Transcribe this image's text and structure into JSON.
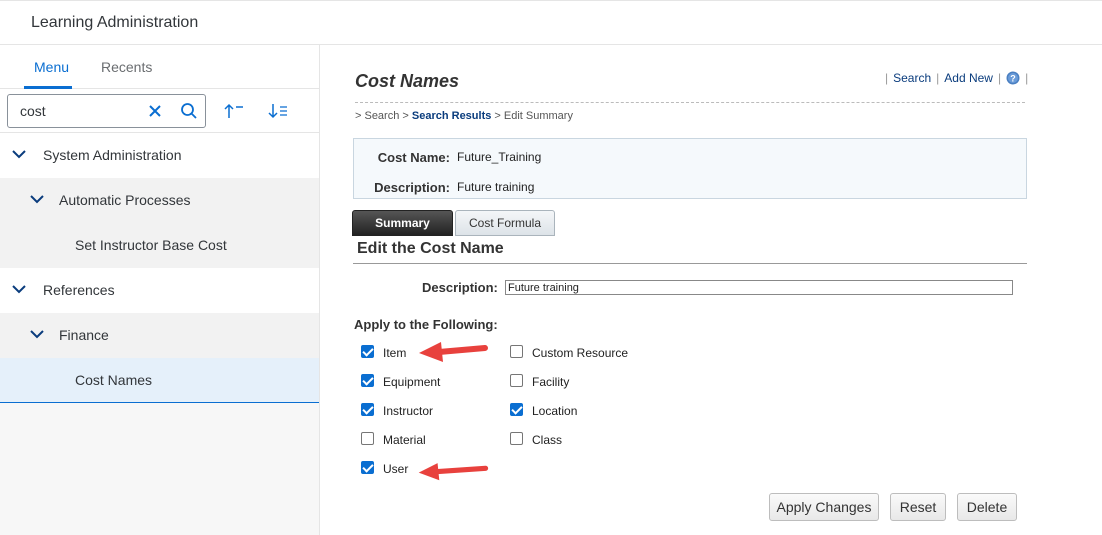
{
  "app": {
    "title": "Learning Administration"
  },
  "sidebar": {
    "tabs": [
      {
        "label": "Menu"
      },
      {
        "label": "Recents"
      }
    ],
    "search": {
      "value": "cost"
    },
    "tree": [
      {
        "label": "System Administration"
      },
      {
        "label": "Automatic Processes"
      },
      {
        "label": "Set Instructor Base Cost"
      },
      {
        "label": "References"
      },
      {
        "label": "Finance"
      },
      {
        "label": "Cost Names"
      }
    ]
  },
  "page": {
    "title": "Cost Names",
    "links": {
      "search": "Search",
      "add_new": "Add New"
    },
    "breadcrumb": {
      "prefix": "> Search > ",
      "current": "Search Results",
      "suffix": " > Edit Summary"
    },
    "info": {
      "cost_name_label": "Cost Name:",
      "cost_name_value": "Future_Training",
      "description_label": "Description:",
      "description_value": "Future training"
    },
    "tabs": [
      {
        "label": "Summary"
      },
      {
        "label": "Cost Formula"
      }
    ],
    "section_title": "Edit the Cost Name",
    "form": {
      "description_label": "Description:",
      "description_value": "Future training",
      "apply_label": "Apply to the Following:"
    },
    "checkboxes_left": [
      {
        "label": "Item",
        "checked": true
      },
      {
        "label": "Equipment",
        "checked": true
      },
      {
        "label": "Instructor",
        "checked": true
      },
      {
        "label": "Material",
        "checked": false
      },
      {
        "label": "User",
        "checked": true
      }
    ],
    "checkboxes_right": [
      {
        "label": "Custom Resource",
        "checked": false
      },
      {
        "label": "Facility",
        "checked": false
      },
      {
        "label": "Location",
        "checked": true
      },
      {
        "label": "Class",
        "checked": false
      }
    ],
    "buttons": {
      "apply": "Apply Changes",
      "reset": "Reset",
      "delete": "Delete"
    }
  },
  "colors": {
    "accent": "#0a6ed1",
    "arrow": "#e8413d"
  },
  "icons": [
    "clear-icon",
    "search-icon",
    "sort-ascending-icon",
    "sort-descending-icon",
    "chevron-down-icon",
    "help-icon",
    "annotation-arrow-icon"
  ]
}
